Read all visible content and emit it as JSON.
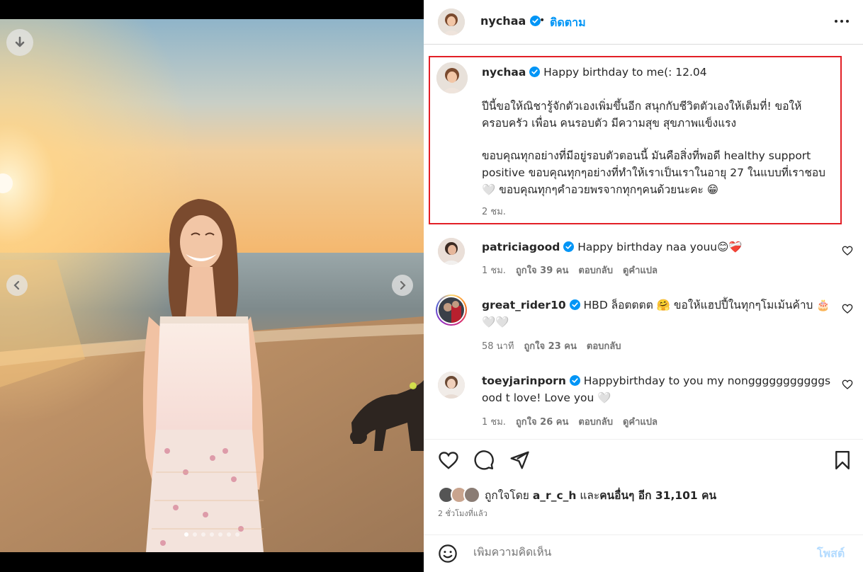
{
  "header": {
    "username": "nychaa",
    "bullet": "•",
    "follow_label": "ติดตาม"
  },
  "caption": {
    "username": "nychaa",
    "line1": "Happy birthday to me(: 12.04",
    "para1": "ปีนี้ขอให้ณิชารู้จักตัวเองเพิ่มขึ้นอีก สนุกกับชีวิตตัวเองให้เต็มที่! ขอให้ครอบครัว เพื่อน คนรอบตัว มีความสุข สุขภาพแข็งแรง",
    "para2": "ขอบคุณทุกอย่างที่มีอยู่รอบตัวตอนนี้ มันคือสิ่งที่พอดี healthy support positive ขอบคุณทุกๆอย่างที่ทำให้เราเป็นเราในอายุ 27 ในแบบที่เราชอบ 🤍 ขอบคุณทุกๆคำอวยพรจากทุกๆคนด้วยนะคะ 😁",
    "time": "2 ชม."
  },
  "comments": [
    {
      "username": "patriciagood",
      "text": "Happy birthday naa youu😊❤️‍🩹",
      "time": "1 ชม.",
      "likes": "ถูกใจ 39 คน",
      "reply": "ตอบกลับ",
      "translate": "ดูคำแปล"
    },
    {
      "username": "great_rider10",
      "text": "HBD ล็อตตตต 🤗 ขอให้แฮปปี้ในทุกๆโมเม้นค้าบ 🎂🤍🤍",
      "time": "58 นาที",
      "likes": "ถูกใจ 23 คน",
      "reply": "ตอบกลับ",
      "translate": ""
    },
    {
      "username": "toeyjarinporn",
      "text": "Happybirthday to you my nongggggggggggsood t love! Love you 🤍",
      "time": "1 ชม.",
      "likes": "ถูกใจ 26 คน",
      "reply": "ตอบกลับ",
      "translate": "ดูคำแปล"
    }
  ],
  "likes_summary": {
    "prefix": "ถูกใจโดย",
    "user": "a_r_c_h",
    "middle": "และ",
    "others": "คนอื่นๆ อีก 31,101 คน"
  },
  "post_time": "2 ชั่วโมงที่แล้ว",
  "add_comment": {
    "placeholder": "เพิ่มความคิดเห็น",
    "post_label": "โพสต์"
  },
  "carousel": {
    "current": 1,
    "total": 7
  },
  "colors": {
    "link_blue": "#0095f6",
    "verified_blue": "#0095f6",
    "highlight_border": "#e21f26",
    "post_disabled": "#b3dbff"
  }
}
